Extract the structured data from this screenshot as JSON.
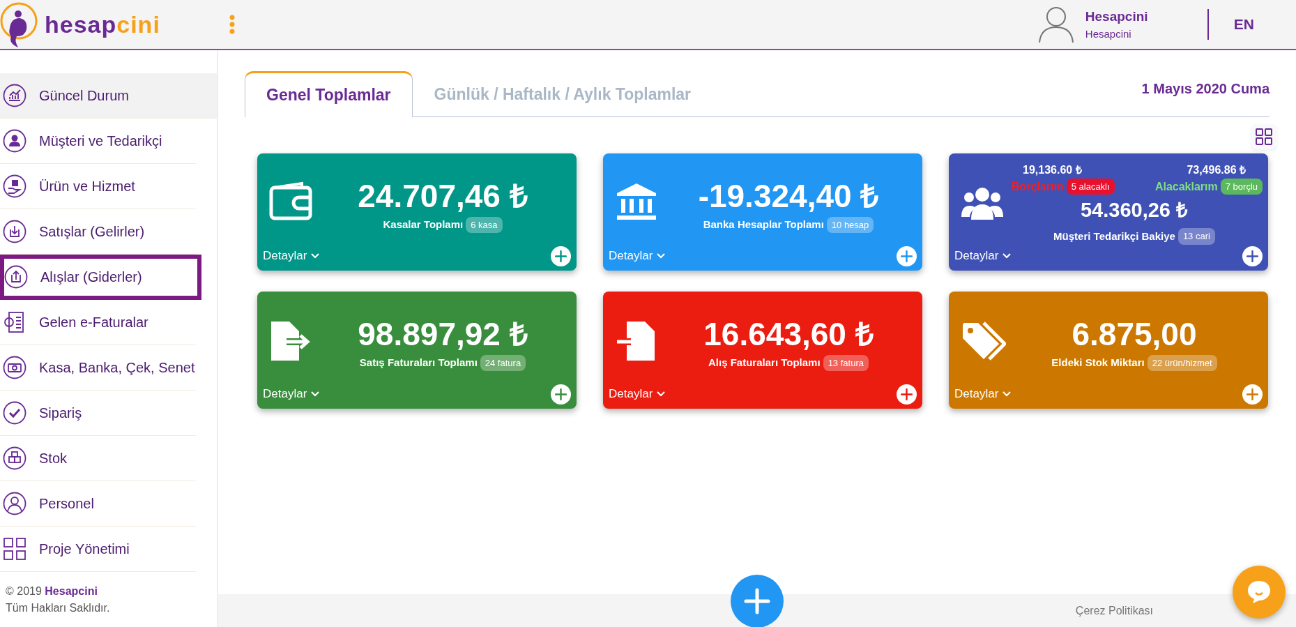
{
  "header": {
    "logo": {
      "part_1": "hesap",
      "part_2": "cini"
    },
    "user": {
      "name": "Hesapcini",
      "company": "Hesapcini"
    },
    "language": "EN"
  },
  "sidebar": {
    "items": [
      {
        "label": "Güncel Durum",
        "selected": true,
        "focused": false
      },
      {
        "label": "Müşteri ve Tedarikçi",
        "selected": false,
        "focused": false
      },
      {
        "label": "Ürün ve Hizmet",
        "selected": false,
        "focused": false
      },
      {
        "label": "Satışlar (Gelirler)",
        "selected": false,
        "focused": false
      },
      {
        "label": "Alışlar (Giderler)",
        "selected": false,
        "focused": true
      },
      {
        "label": "Gelen e-Faturalar",
        "selected": false,
        "focused": false
      },
      {
        "label": "Kasa, Banka, Çek, Senet",
        "selected": false,
        "focused": false
      },
      {
        "label": "Sipariş",
        "selected": false,
        "focused": false
      },
      {
        "label": "Stok",
        "selected": false,
        "focused": false
      },
      {
        "label": "Personel",
        "selected": false,
        "focused": false
      },
      {
        "label": "Proje Yönetimi",
        "selected": false,
        "focused": false
      }
    ],
    "copyright": "© 2019 **Hesapcini**",
    "rights": "Tüm Hakları Saklıdır."
  },
  "tabs": [
    {
      "label": "Genel Toplamlar",
      "selected": true
    },
    {
      "label": "Günlük / Haftalık / Aylık Toplamlar",
      "selected": false
    }
  ],
  "date": "1 Mayıs 2020 Cuma",
  "cards": [
    {
      "kind": "simple",
      "color": "#009688",
      "amount": "24.707,46 ₺",
      "label": "Kasalar Toplamı",
      "badge": "6 kasa",
      "details": "Detaylar"
    },
    {
      "kind": "simple",
      "color": "#2196f3",
      "amount": "-19.324,40 ₺",
      "label": "Banka Hesaplar Toplamı",
      "badge": "10 hesap",
      "details": "Detaylar"
    },
    {
      "kind": "balance",
      "color": "#3f51b5",
      "debt_total": "19,136.60 ₺",
      "credit_total": "73,496.86 ₺",
      "debt_label": "Borçlarım",
      "debt_badge": "5 alacaklı",
      "credit_label": "Alacaklarım",
      "credit_badge": "7 borçlu",
      "amount": "54.360,26 ₺",
      "label": "Müşteri Tedarikçi Bakiye",
      "badge": "13 cari",
      "details": "Detaylar"
    },
    {
      "kind": "simple",
      "color": "#388e3c",
      "amount": "98.897,92 ₺",
      "label": "Satış Faturaları Toplamı",
      "badge": "24 fatura",
      "details": "Detaylar"
    },
    {
      "kind": "simple",
      "color": "#eb1c10",
      "amount": "16.643,60 ₺",
      "label": "Alış Faturaları Toplamı",
      "badge": "13 fatura",
      "details": "Detaylar"
    },
    {
      "kind": "simple",
      "color": "#cc7800",
      "amount": "6.875,00",
      "label": "Eldeki Stok Miktarı",
      "badge": "22 ürün/hizmet",
      "details": "Detaylar"
    }
  ],
  "footer": {
    "cookie_link": "Çerez Politikası"
  }
}
